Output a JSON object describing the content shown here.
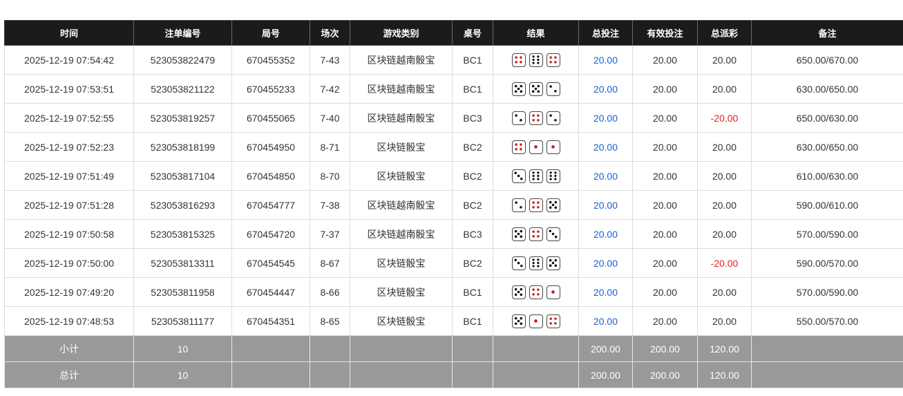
{
  "headers": [
    "时间",
    "注单编号",
    "局号",
    "场次",
    "游戏类别",
    "桌号",
    "结果",
    "总投注",
    "有效投注",
    "总派彩",
    "备注"
  ],
  "rows": [
    {
      "time": "2025-12-19 07:54:42",
      "order": "523053822479",
      "round": "670455352",
      "session": "7-43",
      "game": "区块链越南骰宝",
      "table": "BC1",
      "dice": [
        4,
        6,
        4
      ],
      "total_bet": "20.00",
      "valid_bet": "20.00",
      "payout": "20.00",
      "payout_negative": false,
      "note": "650.00/670.00"
    },
    {
      "time": "2025-12-19 07:53:51",
      "order": "523053821122",
      "round": "670455233",
      "session": "7-42",
      "game": "区块链越南骰宝",
      "table": "BC1",
      "dice": [
        5,
        5,
        2
      ],
      "total_bet": "20.00",
      "valid_bet": "20.00",
      "payout": "20.00",
      "payout_negative": false,
      "note": "630.00/650.00"
    },
    {
      "time": "2025-12-19 07:52:55",
      "order": "523053819257",
      "round": "670455065",
      "session": "7-40",
      "game": "区块链越南骰宝",
      "table": "BC3",
      "dice": [
        2,
        4,
        2
      ],
      "total_bet": "20.00",
      "valid_bet": "20.00",
      "payout": "-20.00",
      "payout_negative": true,
      "note": "650.00/630.00"
    },
    {
      "time": "2025-12-19 07:52:23",
      "order": "523053818199",
      "round": "670454950",
      "session": "8-71",
      "game": "区块链骰宝",
      "table": "BC2",
      "dice": [
        4,
        1,
        1
      ],
      "total_bet": "20.00",
      "valid_bet": "20.00",
      "payout": "20.00",
      "payout_negative": false,
      "note": "630.00/650.00"
    },
    {
      "time": "2025-12-19 07:51:49",
      "order": "523053817104",
      "round": "670454850",
      "session": "8-70",
      "game": "区块链骰宝",
      "table": "BC2",
      "dice": [
        3,
        6,
        6
      ],
      "total_bet": "20.00",
      "valid_bet": "20.00",
      "payout": "20.00",
      "payout_negative": false,
      "note": "610.00/630.00"
    },
    {
      "time": "2025-12-19 07:51:28",
      "order": "523053816293",
      "round": "670454777",
      "session": "7-38",
      "game": "区块链越南骰宝",
      "table": "BC2",
      "dice": [
        2,
        4,
        5
      ],
      "total_bet": "20.00",
      "valid_bet": "20.00",
      "payout": "20.00",
      "payout_negative": false,
      "note": "590.00/610.00"
    },
    {
      "time": "2025-12-19 07:50:58",
      "order": "523053815325",
      "round": "670454720",
      "session": "7-37",
      "game": "区块链越南骰宝",
      "table": "BC3",
      "dice": [
        5,
        4,
        3
      ],
      "total_bet": "20.00",
      "valid_bet": "20.00",
      "payout": "20.00",
      "payout_negative": false,
      "note": "570.00/590.00"
    },
    {
      "time": "2025-12-19 07:50:00",
      "order": "523053813311",
      "round": "670454545",
      "session": "8-67",
      "game": "区块链骰宝",
      "table": "BC2",
      "dice": [
        3,
        6,
        5
      ],
      "total_bet": "20.00",
      "valid_bet": "20.00",
      "payout": "-20.00",
      "payout_negative": true,
      "note": "590.00/570.00"
    },
    {
      "time": "2025-12-19 07:49:20",
      "order": "523053811958",
      "round": "670454447",
      "session": "8-66",
      "game": "区块链骰宝",
      "table": "BC1",
      "dice": [
        5,
        4,
        1
      ],
      "total_bet": "20.00",
      "valid_bet": "20.00",
      "payout": "20.00",
      "payout_negative": false,
      "note": "570.00/590.00"
    },
    {
      "time": "2025-12-19 07:48:53",
      "order": "523053811177",
      "round": "670454351",
      "session": "8-65",
      "game": "区块链骰宝",
      "table": "BC1",
      "dice": [
        5,
        1,
        4
      ],
      "total_bet": "20.00",
      "valid_bet": "20.00",
      "payout": "20.00",
      "payout_negative": false,
      "note": "550.00/570.00"
    }
  ],
  "subtotal": {
    "label": "小计",
    "count": "10",
    "total_bet": "200.00",
    "valid_bet": "200.00",
    "payout": "120.00"
  },
  "total": {
    "label": "总计",
    "count": "10",
    "total_bet": "200.00",
    "valid_bet": "200.00",
    "payout": "120.00"
  },
  "colors": {
    "header_bg": "#1b1b1b",
    "footer_bg": "#999999",
    "bet_blue": "#1a5fd0",
    "loss_red": "#e02020",
    "die_red_pip": "#cc1f1f"
  }
}
